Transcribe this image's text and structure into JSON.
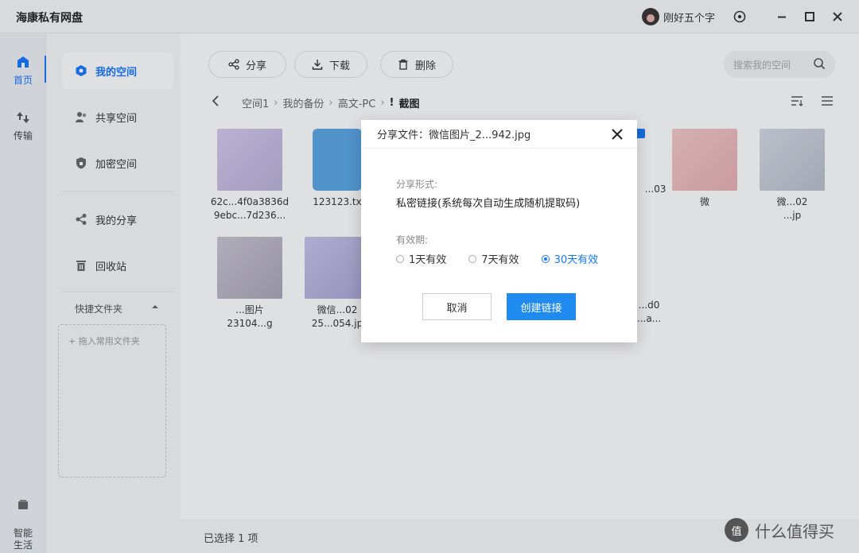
{
  "app": {
    "title": "海康私有网盘"
  },
  "titlebar": {
    "username": "刚好五个字",
    "icons": [
      "settings-icon",
      "minimize-icon",
      "maximize-icon",
      "close-icon"
    ]
  },
  "rail": {
    "items": [
      {
        "label": "首页",
        "icon": "home-icon",
        "active": true
      },
      {
        "label": "传输",
        "icon": "transfer-icon",
        "active": false
      },
      {
        "label": "智能\n生活",
        "icon": "smart-life-icon",
        "active": false
      }
    ]
  },
  "sidebar": {
    "items": [
      {
        "label": "我的空间",
        "icon": "my-space-icon",
        "active": true
      },
      {
        "label": "共享空间",
        "icon": "shared-space-icon",
        "active": false
      },
      {
        "label": "加密空间",
        "icon": "encrypted-space-icon",
        "active": false
      },
      {
        "label": "我的分享",
        "icon": "my-share-icon",
        "active": false
      },
      {
        "label": "回收站",
        "icon": "recycle-bin-icon",
        "active": false
      }
    ],
    "quick_folders_title": "快捷文件夹",
    "quick_add": "+ 拖入常用文件夹"
  },
  "toolbar": {
    "share_label": "分享",
    "download_label": "下载",
    "delete_label": "删除",
    "search_placeholder": "搜索我的空间"
  },
  "breadcrumb": {
    "items": [
      "空间1",
      "我的备份",
      "高文-PC"
    ],
    "current": "截图",
    "current_prefix": "!"
  },
  "files": [
    {
      "line1": "62c...4f0a3836d",
      "line2": "9ebc...7d236..."
    },
    {
      "line1": "123123.tx",
      "line2": ""
    },
    {
      "line1": "...03",
      "line2": ""
    },
    {
      "line1": "微",
      "line2": ""
    },
    {
      "line1": "微...02",
      "line2": "...jp"
    },
    {
      "line1": "...图片",
      "line2": "23104...g"
    },
    {
      "line1": "微信...02",
      "line2": "25...054.jp"
    },
    {
      "line1": "...d0",
      "line2": "...a..."
    }
  ],
  "status": {
    "selected": "已选择 1 项"
  },
  "dialog": {
    "title": "分享文件：微信图片_2...942.jpg",
    "share_form_label": "分享形式:",
    "share_form_value": "私密链接(系统每次自动生成随机提取码)",
    "validity_label": "有效期:",
    "options": [
      {
        "label": "1天有效",
        "checked": false
      },
      {
        "label": "7天有效",
        "checked": false
      },
      {
        "label": "30天有效",
        "checked": true
      }
    ],
    "cancel_label": "取消",
    "create_label": "创建链接"
  },
  "watermark": {
    "text": "什么值得买",
    "logo": "值"
  },
  "colors": {
    "accent": "#1677ff",
    "primary_button": "#1f8bf0"
  }
}
